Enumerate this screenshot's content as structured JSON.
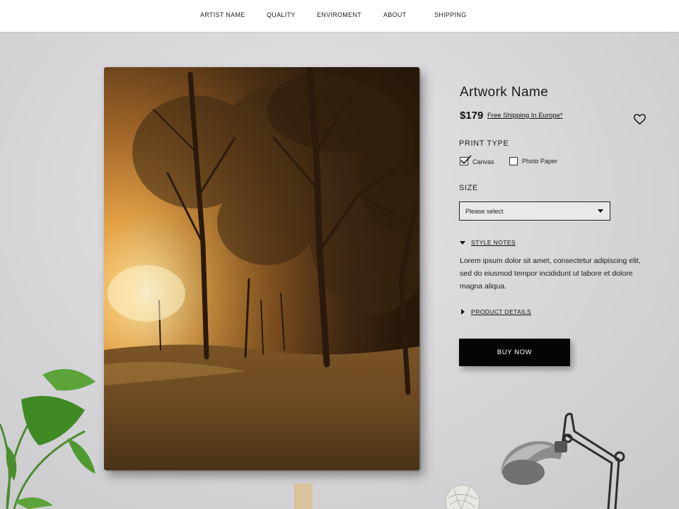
{
  "nav": {
    "items": [
      "ARTIST NAME",
      "QUALITY",
      "ENVIROMENT",
      "ABOUT",
      "SHIPPING"
    ]
  },
  "product": {
    "title": "Artwork Name",
    "price": "$179",
    "shipping_link": "Free Shipping In Europe*",
    "favorite_icon": "heart-icon"
  },
  "print_type": {
    "label": "PRINT TYPE",
    "options": [
      {
        "label": "Canvas",
        "checked": true
      },
      {
        "label": "Photo Paper",
        "checked": false
      }
    ]
  },
  "size": {
    "label": "SIZE",
    "selected": "Please select"
  },
  "style_notes": {
    "label": "STYLE NOTES",
    "expanded": true,
    "text": "Lorem ipsum dolor sit amet, consectetur adipiscing elit, sed do eiusmod tempor incididunt ut labore et dolore magna aliqua."
  },
  "product_details": {
    "label": "PRODUCT DETAILS",
    "expanded": false
  },
  "buy_button": {
    "label": "BUY NOW"
  },
  "colors": {
    "accent": "#000000",
    "background": "#d6d6d8"
  }
}
